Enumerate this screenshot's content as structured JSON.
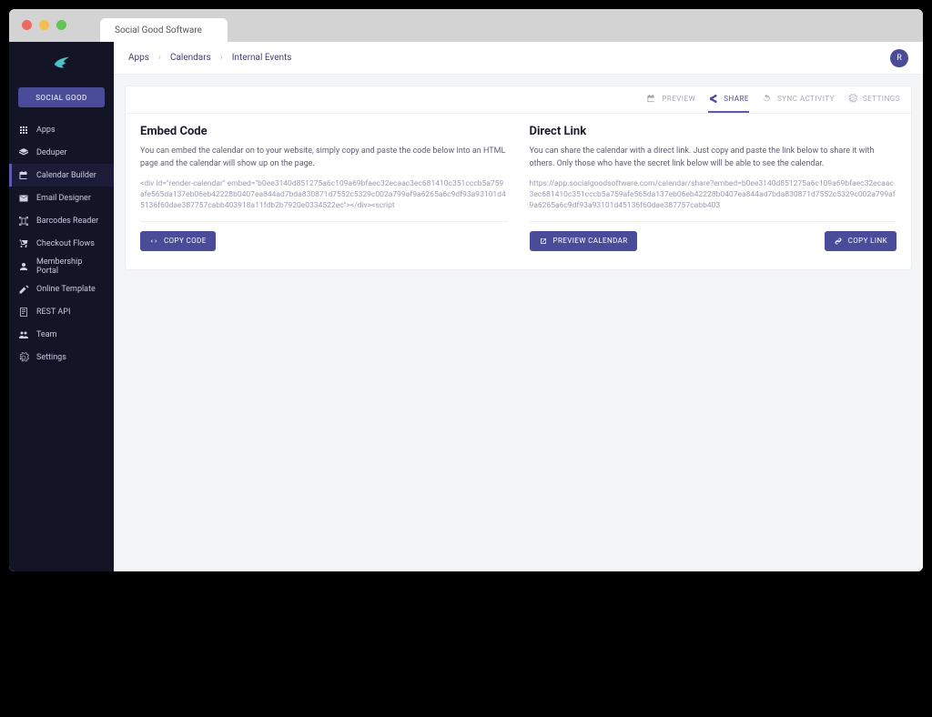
{
  "tab_title": "Social Good Software",
  "brand_button": "SOCIAL GOOD",
  "sidebar": {
    "items": [
      {
        "label": "Apps",
        "icon": "grid-icon"
      },
      {
        "label": "Deduper",
        "icon": "layers-icon"
      },
      {
        "label": "Calendar Builder",
        "icon": "calendar-icon",
        "active": true
      },
      {
        "label": "Email Designer",
        "icon": "mail-icon"
      },
      {
        "label": "Barcodes Reader",
        "icon": "barcode-icon"
      },
      {
        "label": "Checkout Flows",
        "icon": "cart-icon"
      },
      {
        "label": "Membership Portal",
        "icon": "user-icon"
      },
      {
        "label": "Online Template",
        "icon": "pen-icon"
      },
      {
        "label": "REST API",
        "icon": "api-icon"
      },
      {
        "label": "Team",
        "icon": "team-icon"
      },
      {
        "label": "Settings",
        "icon": "gear-icon"
      }
    ]
  },
  "breadcrumbs": [
    "Apps",
    "Calendars",
    "Internal Events"
  ],
  "avatar_initial": "R",
  "subtabs": [
    {
      "label": "PREVIEW",
      "icon": "calendar"
    },
    {
      "label": "SHARE",
      "icon": "share",
      "active": true
    },
    {
      "label": "SYNC ACTIVITY",
      "icon": "sync"
    },
    {
      "label": "SETTINGS",
      "icon": "gear"
    }
  ],
  "embed": {
    "title": "Embed Code",
    "desc": "You can embed the calendar on to your website, simply copy and paste the code below into an HTML page and the calendar will show up on the page.",
    "code": "<div id=\"render-calendar\" embed=\"b0ee3140d851275a6c109a69bfaec32ecaac3ec681410c351cccb5a759afe565da137eb06eb42228b0407ea844ad7bda830871d7552c5329c002a799af9a6265a6c9df93a93101d45136f60dae387757cabb403918a11fdb2b7920e0334522ec\"></div><script",
    "copy_btn": "COPY CODE"
  },
  "direct": {
    "title": "Direct Link",
    "desc": "You can share the calendar with a direct link. Just copy and paste the link below to share it with others. Only those who have the secret link below will be able to see the calendar.",
    "code": "https://app.socialgoodsoftware.com/calendar/share?embed=b0ee3140d851275a6c109a69bfaec32ecaac3ec681410c351cccb5a759afe565da137eb06eb42228b0407ea844ad7bda830871d7552c5329c002a799af9a6265a6c9df93a93101d45136f60dae387757cabb403",
    "preview_btn": "PREVIEW CALENDAR",
    "copy_btn": "COPY LINK"
  }
}
